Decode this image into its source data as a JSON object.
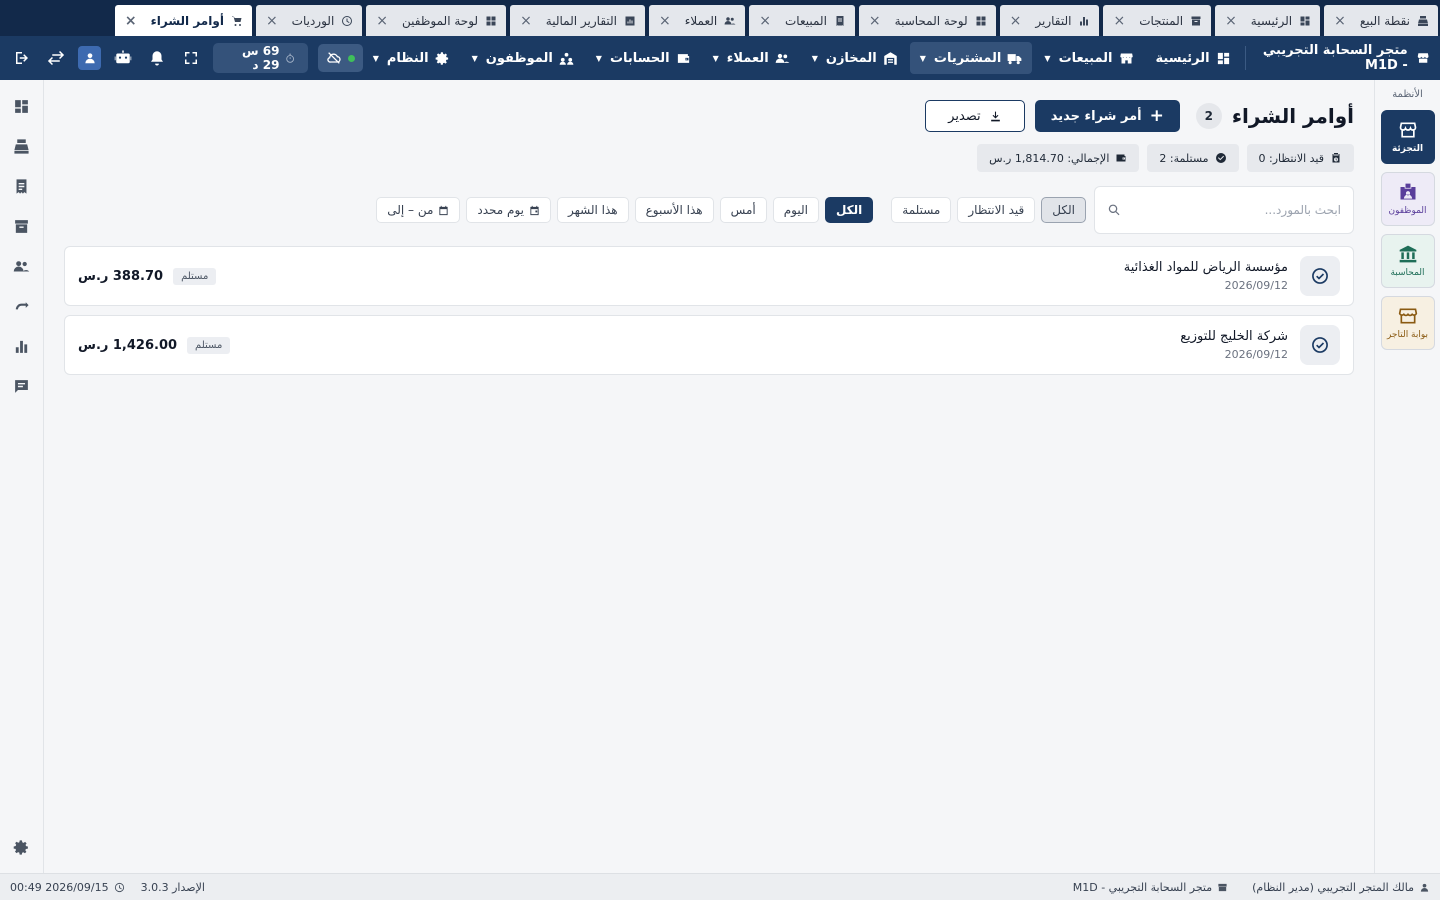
{
  "tabs": [
    {
      "label": "نقطة البيع",
      "icon": "pos-icon",
      "active": false
    },
    {
      "label": "الرئيسية",
      "icon": "dashboard-icon",
      "active": false
    },
    {
      "label": "المنتجات",
      "icon": "box-icon",
      "active": false
    },
    {
      "label": "التقارير",
      "icon": "bar-chart-icon",
      "active": false
    },
    {
      "label": "لوحة المحاسبة",
      "icon": "grid-icon",
      "active": false
    },
    {
      "label": "المبيعات",
      "icon": "receipt-icon",
      "active": false
    },
    {
      "label": "العملاء",
      "icon": "people-icon",
      "active": false
    },
    {
      "label": "التقارير المالية",
      "icon": "report-icon",
      "active": false
    },
    {
      "label": "لوحة الموظفين",
      "icon": "grid-icon",
      "active": false
    },
    {
      "label": "الورديات",
      "icon": "clock-icon",
      "active": false
    },
    {
      "label": "أوامر الشراء",
      "icon": "cart-icon",
      "active": true
    }
  ],
  "nav": {
    "brand": "متجر السحابة التجريبي - M1D",
    "items": [
      {
        "label": "الرئيسية",
        "icon": "dashboard-icon",
        "dropdown": false,
        "active": false
      },
      {
        "label": "المبيعات",
        "icon": "store-icon",
        "dropdown": true,
        "active": false
      },
      {
        "label": "المشتريات",
        "icon": "truck-icon",
        "dropdown": true,
        "active": true
      },
      {
        "label": "المخازن",
        "icon": "warehouse-icon",
        "dropdown": true,
        "active": false
      },
      {
        "label": "العملاء",
        "icon": "people-icon",
        "dropdown": true,
        "active": false
      },
      {
        "label": "الحسابات",
        "icon": "wallet-icon",
        "dropdown": true,
        "active": false
      },
      {
        "label": "الموظفون",
        "icon": "team-icon",
        "dropdown": true,
        "active": false
      },
      {
        "label": "النظام",
        "icon": "gear-icon",
        "dropdown": true,
        "active": false
      }
    ],
    "timer": "69 س 29 د"
  },
  "systems": {
    "title": "الأنظمة",
    "items": [
      {
        "label": "التجزئة",
        "style": "retail"
      },
      {
        "label": "الموظفون",
        "style": "staff"
      },
      {
        "label": "المحاسبة",
        "style": "acct"
      },
      {
        "label": "بوابة التاجر",
        "style": "merchant"
      }
    ]
  },
  "page": {
    "title": "أوامر الشراء",
    "count": "2",
    "new_button": "أمر شراء جديد",
    "export_button": "تصدير"
  },
  "stats": {
    "pending": "قيد الانتظار: 0",
    "received": "مستلمة: 2",
    "total": "الإجمالي: 1,814.70 ر.س"
  },
  "filters": {
    "search_placeholder": "ابحث بالمورد...",
    "status": [
      {
        "label": "الكل",
        "selected": true
      },
      {
        "label": "قيد الانتظار",
        "selected": false
      },
      {
        "label": "مستلمة",
        "selected": false
      }
    ],
    "period": [
      {
        "label": "الكل",
        "selected": true
      },
      {
        "label": "اليوم",
        "selected": false
      },
      {
        "label": "أمس",
        "selected": false
      },
      {
        "label": "هذا الأسبوع",
        "selected": false
      },
      {
        "label": "هذا الشهر",
        "selected": false
      }
    ],
    "specific_day": "يوم محدد",
    "range": "من – إلى"
  },
  "orders": [
    {
      "supplier": "مؤسسة الرياض للمواد الغذائية",
      "date": "2026/09/12",
      "status": "مستلم",
      "amount": "388.70 ر.س"
    },
    {
      "supplier": "شركة الخليج للتوزيع",
      "date": "2026/09/12",
      "status": "مستلم",
      "amount": "1,426.00 ر.س"
    }
  ],
  "footer": {
    "user": "مالك المتجر التجريبي (مدير النظام)",
    "store": "متجر السحابة التجريبي - M1D",
    "version": "الإصدار 3.0.3",
    "datetime": "2026/09/15  00:49"
  }
}
